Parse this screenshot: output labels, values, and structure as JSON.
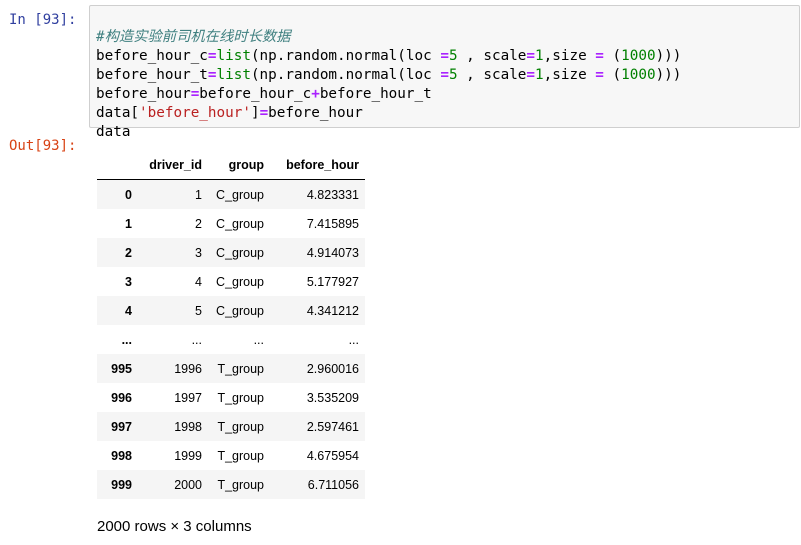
{
  "input_prompt": "In [93]:",
  "output_prompt": "Out[93]:",
  "code": {
    "line1": "#构造实验前司机在线时长数据",
    "line2": {
      "a": "before_hour_c",
      "op": "=",
      "fn": "list",
      "b": "(np.random.normal(loc ",
      "op2": "=",
      "n1": "5",
      "c": " , scale",
      "op3": "=",
      "n2": "1",
      "d": ",size ",
      "op4": "=",
      "e": " (",
      "n3": "1000",
      "f": ")))"
    },
    "line3": {
      "a": "before_hour_t",
      "op": "=",
      "fn": "list",
      "b": "(np.random.normal(loc ",
      "op2": "=",
      "n1": "5",
      "c": " , scale",
      "op3": "=",
      "n2": "1",
      "d": ",size ",
      "op4": "=",
      "e": " (",
      "n3": "1000",
      "f": ")))"
    },
    "line4": {
      "a": "before_hour",
      "op": "=",
      "b": "before_hour_c",
      "op2": "+",
      "c": "before_hour_t"
    },
    "line5": {
      "a": "data[",
      "str": "'before_hour'",
      "b": "]",
      "op": "=",
      "c": "before_hour"
    },
    "line6": "data"
  },
  "table": {
    "columns": [
      "",
      "driver_id",
      "group",
      "before_hour"
    ],
    "rows": [
      {
        "index": "0",
        "driver_id": "1",
        "group": "C_group",
        "before_hour": "4.823331"
      },
      {
        "index": "1",
        "driver_id": "2",
        "group": "C_group",
        "before_hour": "7.415895"
      },
      {
        "index": "2",
        "driver_id": "3",
        "group": "C_group",
        "before_hour": "4.914073"
      },
      {
        "index": "3",
        "driver_id": "4",
        "group": "C_group",
        "before_hour": "5.177927"
      },
      {
        "index": "4",
        "driver_id": "5",
        "group": "C_group",
        "before_hour": "4.341212"
      },
      {
        "index": "...",
        "driver_id": "...",
        "group": "...",
        "before_hour": "..."
      },
      {
        "index": "995",
        "driver_id": "1996",
        "group": "T_group",
        "before_hour": "2.960016"
      },
      {
        "index": "996",
        "driver_id": "1997",
        "group": "T_group",
        "before_hour": "3.535209"
      },
      {
        "index": "997",
        "driver_id": "1998",
        "group": "T_group",
        "before_hour": "2.597461"
      },
      {
        "index": "998",
        "driver_id": "1999",
        "group": "T_group",
        "before_hour": "4.675954"
      },
      {
        "index": "999",
        "driver_id": "2000",
        "group": "T_group",
        "before_hour": "6.711056"
      }
    ]
  },
  "shape_text": "2000 rows × 3 columns"
}
